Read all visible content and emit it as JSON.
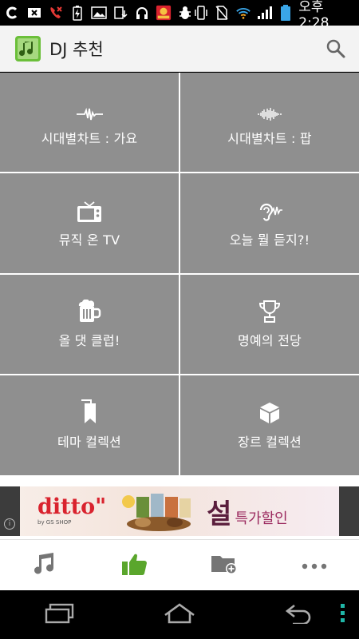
{
  "status_bar": {
    "time": "오후 2:28",
    "icons": [
      "c-icon",
      "notification-icon",
      "missed-call-icon",
      "charging-icon",
      "gallery-icon",
      "download-icon",
      "headset-icon",
      "app-icon",
      "bug-icon",
      "vibrate-icon",
      "no-sim-icon",
      "wifi-icon",
      "signal-icon",
      "battery-icon"
    ]
  },
  "app_bar": {
    "title": "DJ 추천",
    "logo_icon": "music-note-logo-icon",
    "search_icon": "search-icon"
  },
  "grid": {
    "tiles": [
      {
        "label": "시대별차트 : 가요",
        "icon": "waveform-small-icon"
      },
      {
        "label": "시대별차트 : 팝",
        "icon": "waveform-dense-icon"
      },
      {
        "label": "뮤직 온 TV",
        "icon": "tv-icon"
      },
      {
        "label": "오늘 뭘 듣지?!",
        "icon": "ear-sound-icon"
      },
      {
        "label": "올 댓 클럽!",
        "icon": "beer-mug-icon"
      },
      {
        "label": "명예의 전당",
        "icon": "trophy-icon"
      },
      {
        "label": "테마 컬렉션",
        "icon": "bookmark-icon"
      },
      {
        "label": "장르 컬렉션",
        "icon": "cube-icon"
      }
    ]
  },
  "ad": {
    "brand": "ditto\"",
    "brand_sub": "by GS SHOP",
    "promo_big": "설",
    "promo_small": "특가할인",
    "info_label": "i"
  },
  "bottom_tabs": [
    {
      "icon": "music-note-icon",
      "active": false
    },
    {
      "icon": "thumbs-up-icon",
      "active": true
    },
    {
      "icon": "folder-add-icon",
      "active": false
    },
    {
      "icon": "more-icon",
      "active": false
    }
  ],
  "colors": {
    "tile_bg": "#8f8f8f",
    "active_tab": "#5aa62c",
    "inactive_tab": "#757575",
    "app_bar_bg": "#f3f3f3"
  }
}
